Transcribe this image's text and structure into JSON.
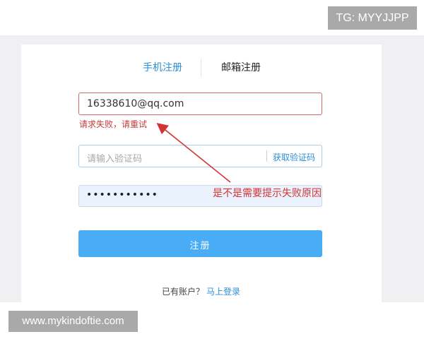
{
  "watermark": {
    "top": "TG: MYYJJPP",
    "bottom": "www.mykindoftie.com"
  },
  "tabs": {
    "phone_label": "手机注册",
    "email_label": "邮箱注册",
    "active": "phone"
  },
  "form": {
    "email": {
      "value": "16338610@qq.com"
    },
    "error": "请求失败，请重试",
    "code": {
      "placeholder": "请输入验证码",
      "get_code_label": "获取验证码"
    },
    "password": {
      "masked_value": "•••••••••••"
    },
    "submit_label": "注册"
  },
  "annotation": {
    "text": "是不是需要提示失败原因"
  },
  "footer": {
    "prompt": "已有账户？",
    "login_link": "马上登录"
  },
  "colors": {
    "accent": "#2b8fd6",
    "button": "#48adf4",
    "error": "#c63b3b",
    "annotation": "#d23434"
  }
}
